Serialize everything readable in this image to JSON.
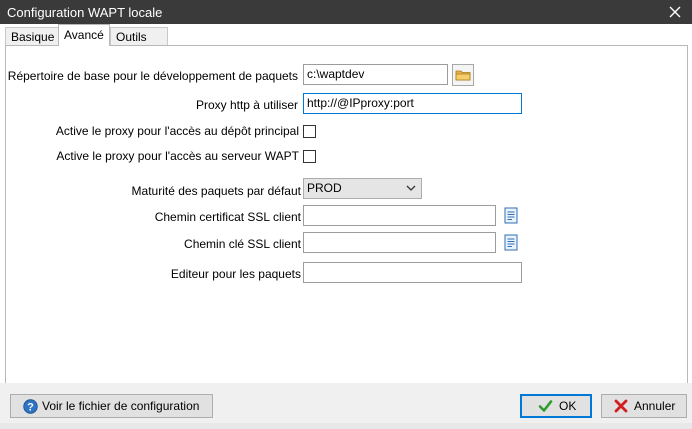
{
  "window": {
    "title": "Configuration WAPT locale"
  },
  "tabs": [
    {
      "label": "Basique"
    },
    {
      "label": "Avancé"
    },
    {
      "label": "Outils externes"
    }
  ],
  "form": {
    "base_dir": {
      "label": "Répertoire de base pour le développement de paquets",
      "value": "c:\\waptdev"
    },
    "proxy": {
      "label": "Proxy http à utiliser",
      "value": "http://@IPproxy:port"
    },
    "proxy_repo": {
      "label": "Active le proxy pour l'accès au dépôt principal",
      "checked": false
    },
    "proxy_server": {
      "label": "Active le proxy pour l'accès au serveur WAPT",
      "checked": false
    },
    "maturity": {
      "label": "Maturité des paquets par défaut",
      "value": "PROD"
    },
    "ssl_cert": {
      "label": "Chemin certificat SSL client",
      "value": ""
    },
    "ssl_key": {
      "label": "Chemin clé SSL client",
      "value": ""
    },
    "editor": {
      "label": "Editeur pour les paquets",
      "value": ""
    }
  },
  "footer": {
    "view_config": "Voir le fichier de configuration",
    "ok": "OK",
    "cancel": "Annuler"
  },
  "colors": {
    "accent": "#0078d7",
    "titlebar": "#3a3a3a",
    "ok_check": "#2e9b2e",
    "cancel_x": "#d11f1f"
  },
  "icons": [
    "close-icon",
    "folder-icon",
    "file-browse-icon",
    "chevron-down-icon",
    "help-icon",
    "check-icon",
    "cancel-x-icon"
  ]
}
